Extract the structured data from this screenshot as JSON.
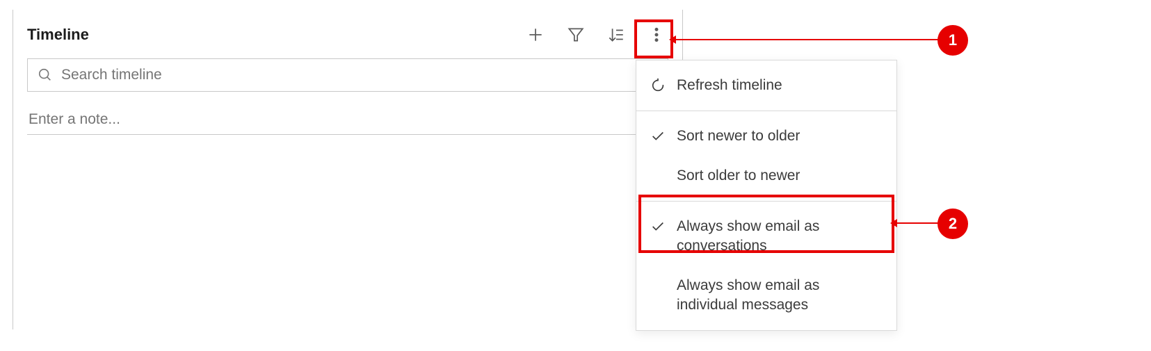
{
  "panel": {
    "title": "Timeline"
  },
  "search": {
    "placeholder": "Search timeline"
  },
  "note": {
    "placeholder": "Enter a note..."
  },
  "menu": {
    "refresh": "Refresh timeline",
    "sort_newer": "Sort newer to older",
    "sort_older": "Sort older to newer",
    "email_conv": "Always show email as conversations",
    "email_indiv": "Always show email as individual messages"
  },
  "callouts": {
    "one": "1",
    "two": "2"
  }
}
